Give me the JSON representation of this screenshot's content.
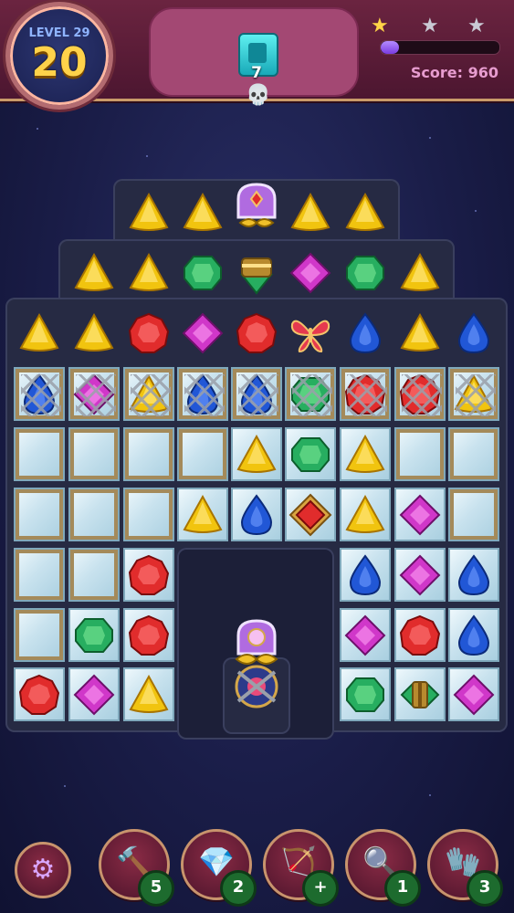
{
  "hud": {
    "level_label": "LEVEL 29",
    "moves_left": "20",
    "goal": {
      "icon": "cyan-tile-icon",
      "count": "7"
    },
    "stars_earned": 1,
    "stars_total": 3,
    "score_label": "Score: 960",
    "score_progress": 0.15,
    "skull_icon": "skull-icon"
  },
  "gem_colors": {
    "yellow": "#f1c40f",
    "green": "#27ae60",
    "red": "#e12c2c",
    "blue": "#2157d6",
    "purple": "#d037c9"
  },
  "board": {
    "rows": [
      [
        "none",
        "none",
        "yellow",
        "yellow",
        "key-lock",
        "yellow",
        "yellow",
        "none",
        "none"
      ],
      [
        "none",
        "yellow",
        "yellow",
        "green",
        "green-rocket",
        "purple",
        "green",
        "yellow",
        "none"
      ],
      [
        "yellow",
        "yellow",
        "red",
        "purple",
        "red",
        "butterfly",
        "blue",
        "yellow",
        "blue"
      ],
      [
        "blue",
        "purple",
        "yellow",
        "blue",
        "blue",
        "green",
        "red",
        "red",
        "yellow"
      ],
      [
        "empty",
        "empty",
        "empty",
        "empty",
        "yellow",
        "green",
        "yellow",
        "empty",
        "empty"
      ],
      [
        "empty",
        "empty",
        "empty",
        "yellow",
        "blue",
        "red-special",
        "yellow",
        "purple",
        "empty"
      ],
      [
        "empty",
        "empty",
        "red",
        "hole",
        "hole",
        "hole",
        "blue",
        "purple",
        "blue"
      ],
      [
        "empty",
        "green",
        "red",
        "hole",
        "hole",
        "hole",
        "purple",
        "red",
        "blue"
      ],
      [
        "red",
        "purple",
        "yellow",
        "hole",
        "lantern",
        "hole",
        "green",
        "green-bomb",
        "purple"
      ]
    ],
    "chained_row": 3,
    "ice_rows": [
      3,
      4,
      5,
      6,
      7,
      8
    ]
  },
  "boosters": [
    {
      "name": "hammer",
      "icon": "hammer-icon",
      "count": "5"
    },
    {
      "name": "shuffle-gem",
      "icon": "swap-gem-icon",
      "count": "2"
    },
    {
      "name": "bow-drill",
      "icon": "bow-drill-icon",
      "count": "+"
    },
    {
      "name": "magnifier",
      "icon": "magnifier-icon",
      "count": "1"
    },
    {
      "name": "glove",
      "icon": "glove-icon",
      "count": "3"
    }
  ],
  "settings_icon": "gear-icon"
}
